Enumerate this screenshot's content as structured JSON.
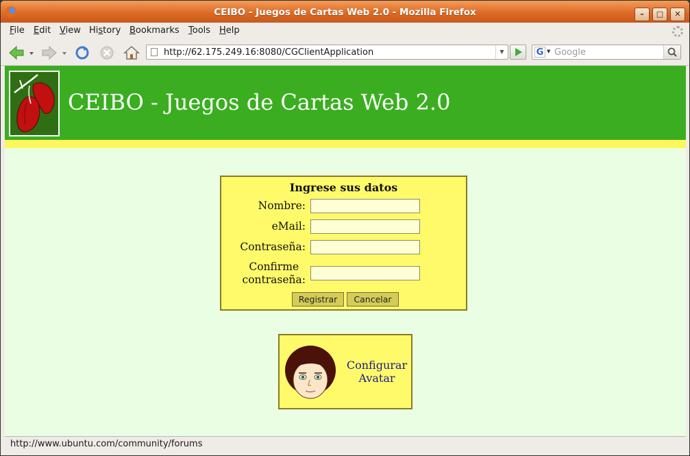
{
  "window": {
    "title": "CEIBO - Juegos de Cartas Web 2.0 - Mozilla Firefox",
    "controls": {
      "minimize": "–",
      "maximize": "□",
      "close": "✕"
    }
  },
  "menubar": {
    "items": [
      {
        "label": "File",
        "key": "F"
      },
      {
        "label": "Edit",
        "key": "E"
      },
      {
        "label": "View",
        "key": "V"
      },
      {
        "label": "History",
        "key": "s"
      },
      {
        "label": "Bookmarks",
        "key": "B"
      },
      {
        "label": "Tools",
        "key": "T"
      },
      {
        "label": "Help",
        "key": "H"
      }
    ]
  },
  "toolbar": {
    "url": "http://62.175.249.16:8080/CGClientApplication",
    "search_placeholder": "Google",
    "search_engine_icon": "G"
  },
  "page": {
    "header_title": "CEIBO - Juegos de Cartas Web 2.0",
    "colors": {
      "header": "#3aae20",
      "stripe": "#fff55d",
      "background": "#e9fee2",
      "panel": "#fffa6a",
      "button": "#d4cc57"
    },
    "form": {
      "title": "Ingrese sus datos",
      "fields": {
        "nombre": {
          "label": "Nombre:",
          "value": ""
        },
        "email": {
          "label": "eMail:",
          "value": ""
        },
        "password": {
          "label": "Contraseña:",
          "value": ""
        },
        "confirm": {
          "label_line1": "Confirme",
          "label_line2": "contraseña:",
          "value": ""
        }
      },
      "buttons": {
        "register": "Registrar",
        "cancel": "Cancelar"
      }
    },
    "avatar": {
      "line1": "Configurar",
      "line2": "Avatar"
    }
  },
  "statusbar": {
    "text": "http://www.ubuntu.com/community/forums"
  }
}
